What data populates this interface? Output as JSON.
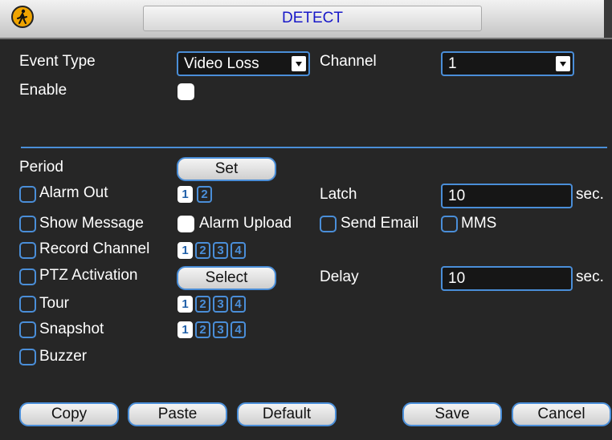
{
  "window": {
    "title": "DETECT"
  },
  "event_type": {
    "label": "Event Type",
    "value": "Video Loss"
  },
  "channel": {
    "label": "Channel",
    "value": "1"
  },
  "enable": {
    "label": "Enable",
    "checked": false
  },
  "period": {
    "label": "Period",
    "button": "Set"
  },
  "alarm_out": {
    "label": "Alarm Out",
    "checked": false,
    "outputs": [
      "1",
      "2"
    ],
    "selected": [
      "1"
    ]
  },
  "latch": {
    "label": "Latch",
    "value": "10",
    "unit": "sec."
  },
  "show_message": {
    "label": "Show Message",
    "checked": false
  },
  "alarm_upload": {
    "label": "Alarm Upload",
    "checked": false
  },
  "send_email": {
    "label": "Send Email",
    "checked": false
  },
  "mms": {
    "label": "MMS",
    "checked": false
  },
  "record_channel": {
    "label": "Record Channel",
    "checked": false,
    "channels": [
      "1",
      "2",
      "3",
      "4"
    ],
    "selected": [
      "1"
    ]
  },
  "ptz_activation": {
    "label": "PTZ Activation",
    "checked": false,
    "button": "Select"
  },
  "delay": {
    "label": "Delay",
    "value": "10",
    "unit": "sec."
  },
  "tour": {
    "label": "Tour",
    "checked": false,
    "channels": [
      "1",
      "2",
      "3",
      "4"
    ],
    "selected": [
      "1"
    ]
  },
  "snapshot": {
    "label": "Snapshot",
    "checked": false,
    "channels": [
      "1",
      "2",
      "3",
      "4"
    ],
    "selected": [
      "1"
    ]
  },
  "buzzer": {
    "label": "Buzzer",
    "checked": false
  },
  "footer": {
    "copy": "Copy",
    "paste": "Paste",
    "default": "Default",
    "save": "Save",
    "cancel": "Cancel"
  },
  "colors": {
    "accent": "#4a8ed8",
    "background": "#262626",
    "title_text": "#1818c8",
    "logo": "#f0a400"
  },
  "icons": {
    "logo": "pedestrian-detect-icon"
  }
}
